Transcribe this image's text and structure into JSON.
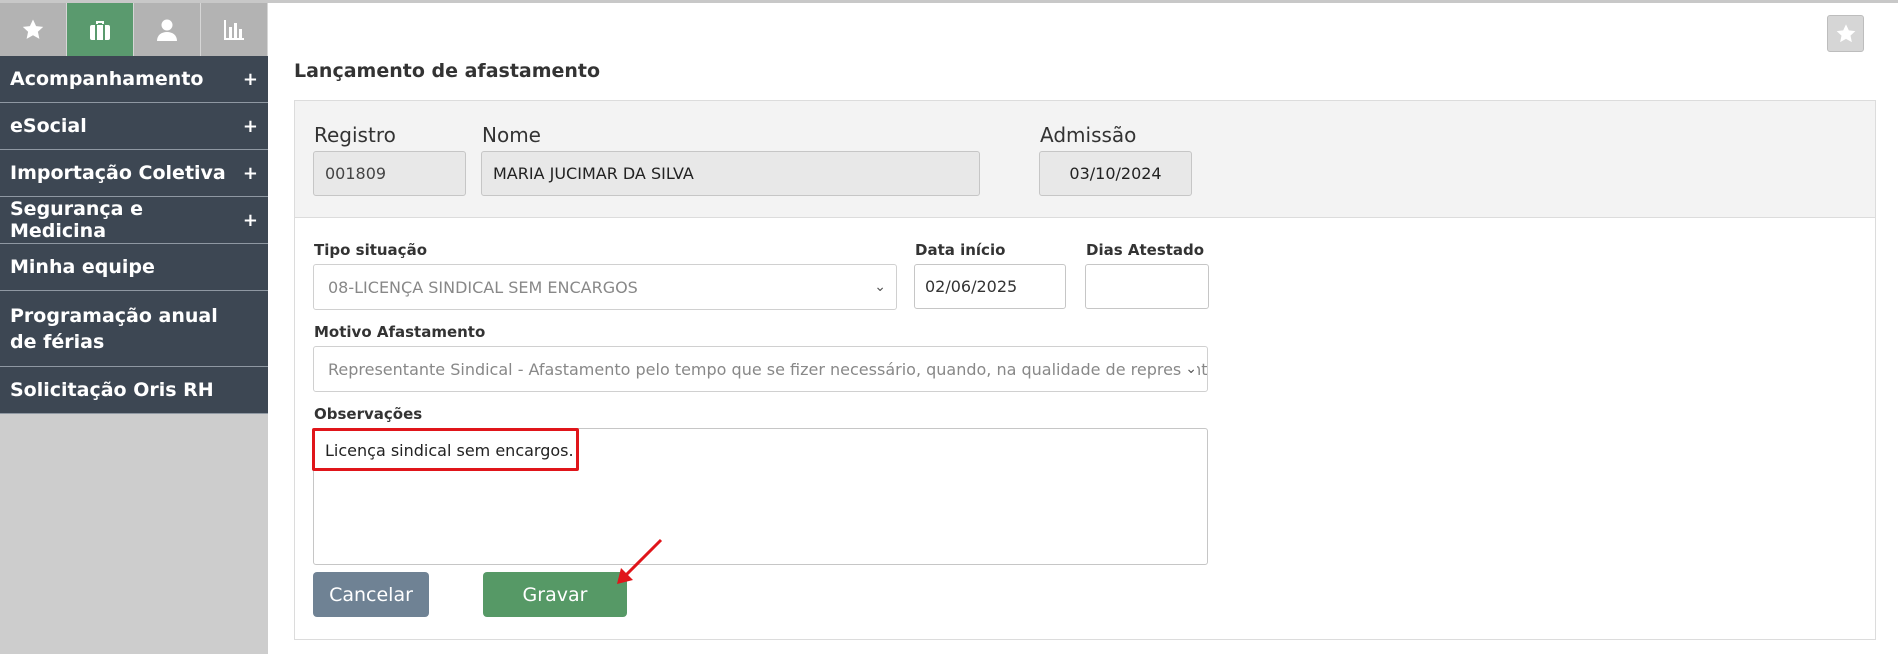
{
  "sidebar": {
    "top_icons": [
      {
        "icon": "star-icon",
        "active": false
      },
      {
        "icon": "briefcase-icon",
        "active": true
      },
      {
        "icon": "user-icon",
        "active": false
      },
      {
        "icon": "bar-chart-icon",
        "active": false
      }
    ],
    "items": [
      {
        "label": "Acompanhamento",
        "expand": "+"
      },
      {
        "label": "eSocial",
        "expand": "+"
      },
      {
        "label": "Importação Coletiva",
        "expand": "+"
      },
      {
        "label": "Segurança e Medicina",
        "expand": "+"
      },
      {
        "label": "Minha equipe",
        "expand": ""
      },
      {
        "label": "Programação anual de férias",
        "expand": ""
      },
      {
        "label": "Solicitação Oris RH",
        "expand": ""
      }
    ]
  },
  "page": {
    "title": "Lançamento de afastamento"
  },
  "employee": {
    "registro_label": "Registro",
    "registro_value": "001809",
    "nome_label": "Nome",
    "nome_value": "MARIA JUCIMAR DA SILVA",
    "admissao_label": "Admissão",
    "admissao_value": "03/10/2024"
  },
  "form": {
    "tipo_label": "Tipo situação",
    "tipo_value": "08-LICENÇA SINDICAL SEM ENCARGOS",
    "data_inicio_label": "Data início",
    "data_inicio_value": "02/06/2025",
    "dias_label": "Dias Atestado",
    "dias_value": "",
    "motivo_label": "Motivo Afastamento",
    "motivo_value": "Representante Sindical - Afastamento pelo tempo que se fizer necessário, quando, na qualidade de representante",
    "obs_label": "Observações",
    "obs_value": "Licença sindical sem encargos.",
    "cancel_label": "Cancelar",
    "save_label": "Gravar"
  },
  "colors": {
    "sidebar_item_bg": "#3d4753",
    "active_tab": "#5a9a6e",
    "save_button": "#569966",
    "cancel_button": "#6f8294",
    "highlight": "#e0151a"
  }
}
